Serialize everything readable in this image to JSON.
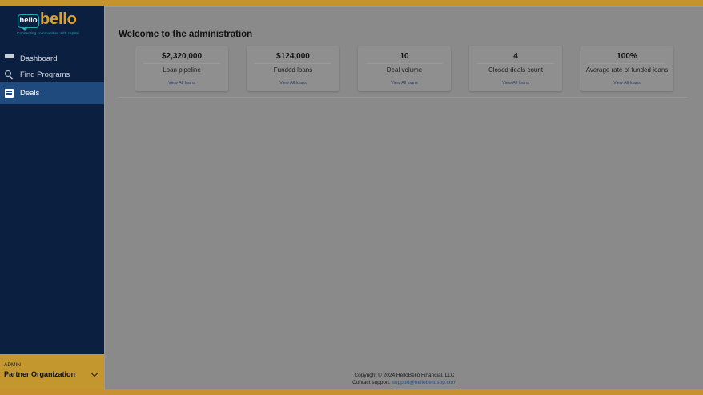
{
  "brand": {
    "hello": "hello",
    "bello": "bello",
    "tagline": "Connecting communities with capital"
  },
  "nav": [
    {
      "label": "Dashboard",
      "icon": "dashboard-icon"
    },
    {
      "label": "Find Programs",
      "icon": "search-icon"
    },
    {
      "label": "Deals",
      "icon": "document-icon",
      "active": true
    }
  ],
  "org": {
    "role": "ADMIN",
    "name": "Partner Organization"
  },
  "page": {
    "title": "Welcome to the administration"
  },
  "cards": [
    {
      "value": "$2,320,000",
      "label": "Loan pipeline",
      "link": "View All loans"
    },
    {
      "value": "$124,000",
      "label": "Funded loans",
      "link": "View All loans"
    },
    {
      "value": "10",
      "label": "Deal volume",
      "link": "View All loans"
    },
    {
      "value": "4",
      "label": "Closed deals count",
      "link": "View All loans"
    },
    {
      "value": "100%",
      "label": "Average rate of funded loans",
      "link": "View All loans"
    }
  ],
  "footer": {
    "copyright": "Copyright © 2024 HelloBello Financial, LLC",
    "support_label": "Contact support:",
    "support_email": "support@hellobellosbp.com"
  },
  "colors": {
    "sidebar": "#0b1f41",
    "active_nav": "#1e4a7d",
    "accent_gold": "#c4962e",
    "teal": "#2aa6b5"
  }
}
